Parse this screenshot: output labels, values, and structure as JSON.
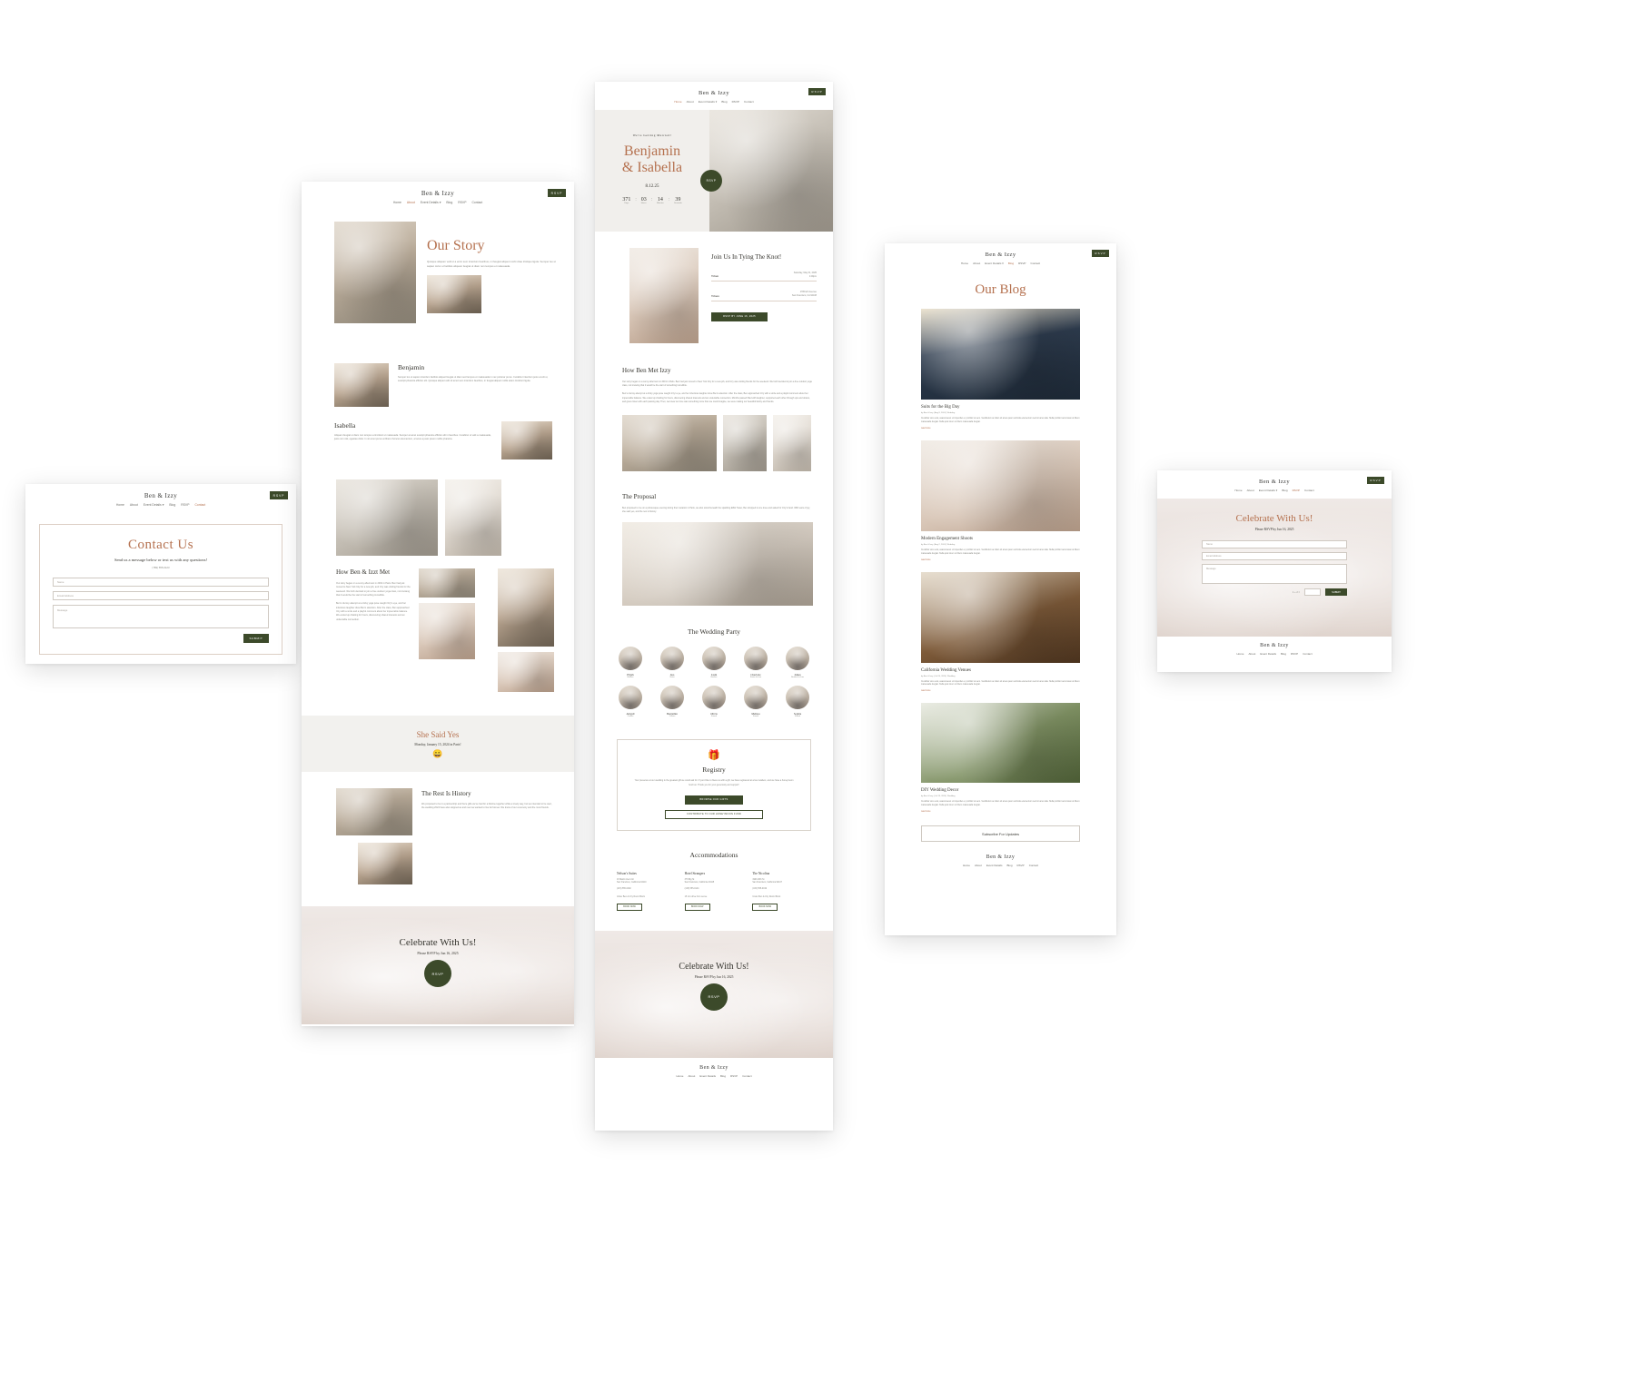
{
  "site": {
    "brand": "Ben & Izzy",
    "nav": [
      "Home",
      "About",
      "Event Details",
      "Blog",
      "RSVP",
      "Contact"
    ],
    "nav_dropdown_marker": "▾",
    "rsvp_button": "RSVP",
    "footer_brand": "Ben & Izzy"
  },
  "contact_page": {
    "title": "Contact Us",
    "subtitle": "Send us a message below or text us with any questions!",
    "phone": "(789) 555-0123",
    "fields": [
      {
        "placeholder": "Name"
      },
      {
        "placeholder": "Email Address"
      },
      {
        "placeholder": "Message"
      }
    ],
    "submit_label": "SUBMIT",
    "active_nav": "Contact"
  },
  "story_page": {
    "active_nav": "About",
    "title": "Our Story",
    "intro": "Quisque aliquam velit ut a enim sem interdum faucibus, mi feugiat aliquet morbi vitae tristique ligula. Semper leo ut sapien tortor et facilisis aliquam feugiat ut diam non tempus et malesuada.",
    "people": [
      {
        "name": "Benjamin",
        "bio": "Semper leo ut sapien interdum facilisis aliquet feugiat ut diam sed tempus et malesuada in nec pulvinar purus. Curabitur interdum justo at elit ut, suscipit pharetra efficitur elit. Quisque aliquet velit sit amet sem interdum faucibus, in feugiat aliquet mollis etiam tincidunt ligula."
      },
      {
        "name": "Isabella",
        "bio": "Aliquam feugiat ut diam non tempus a tincidunt ut malesuada. Semper at amet suscipit pharetra efficitur elit in faucibus. Curabitur ut velit a malesuada, justo non nisl, egestas dolor. In sit amet purus at libero rhoncus elementum, a lacus a justo ipsum mollis pharetra."
      }
    ],
    "how_met_title": "How Ben & Izzt Met",
    "how_met_p1": "Our story began on a sunny afternoon in 2019 in Paris. Ben had just moved to New York City for a new job, and Izzy was visiting friends for the weekend. We both decided to join a free outdoor yoga class, not knowing that it would be the start of something incredible.",
    "how_met_p2": "Ben's clumsy attempt at a tricky yoga pose caught Izzy's eye, and her infectious laughter drew Ben's attention. After the class, Ben approached Izzy with a smile and a playful comment about her impeccable balance. We ended up chatting for hours, discovering shared interests and an undeniable connection.",
    "she_said_yes": {
      "title": "She Said Yes",
      "subtitle": "Monday, January 15, 2024 in Paris!",
      "emoji": "😀"
    },
    "rest_is_history": {
      "title": "The Rest Is History",
      "body": "We proposed to be in a partnership and there gifts we've had for a lifetime together while a lovely way, but we intended to be wed, the wedding 2024 have also stopped as and new we wanted to live far forever. We know of our ceremony and the most friends."
    },
    "celebrate": {
      "title": "Celebrate With Us!",
      "subtitle": "Please RSVP by Jun 16, 2025",
      "button": "RSVP"
    }
  },
  "home_page": {
    "active_nav": "Home",
    "eyebrow": "We're Getting Married!",
    "name_line1": "Benjamin",
    "name_line2": "& Isabella",
    "date": "8.12.25",
    "rsvp_badge": "RSVP",
    "countdown": [
      {
        "value": "371",
        "label": "Days"
      },
      {
        "value": "03",
        "label": "Hours"
      },
      {
        "value": "14",
        "label": "Minutes"
      },
      {
        "value": "39",
        "label": "Seconds"
      }
    ],
    "countdown_sep": ":",
    "details": {
      "title": "Join Us In Tying The Knot!",
      "rows": [
        {
          "label": "When",
          "value": "Saturday, May 31, 2025\n4:00pm"
        },
        {
          "label": "Where",
          "value": "1786 Erb Avenue\nSan Francisco, CA 94108"
        }
      ],
      "button": "RSVP BY JUNE 16, 2025"
    },
    "how_met": {
      "title": "How Ben Met Izzy",
      "p1": "Our story began on a sunny afternoon in 2019 in Paris. Ben had just moved to New York City for a new job, and Izzy was visiting friends for the weekend. We both decided to join a free outdoor yoga class, not knowing that it would be the start of something incredible.",
      "p2": "Ben's clumsy attempt at a tricky yoga pose caught Izzy's eye, and her infectious laughter drew Ben's attention. After the class, Ben approached Izzy with a smile and a playful comment about her impeccable balance. We ended up chatting for hours, discovering shared interests and an undeniable connection. Months passed filled with laughter, supported each other through ups and downs, and grew closer with each passing day. Then, we knew our love was something more than we could imagine, we were making our beautiful family and friends."
    },
    "proposal": {
      "title": "The Proposal",
      "body": "Ben proposed to me on a picturesque evening during their vacation in Paris, we also stood beneath the sparkling Eiffel Tower, Ben dropped to one knee and asked for Izzy's hand. With tears of joy, she said yes, and the rest is history."
    },
    "wedding_party": {
      "title": "The Wedding Party",
      "members": [
        {
          "name": "Elijah",
          "role": "Brother"
        },
        {
          "name": "Ava",
          "role": "Sister"
        },
        {
          "name": "Liam",
          "role": "Brother"
        },
        {
          "name": "Charlotte",
          "role": "Sister-In-Law"
        },
        {
          "name": "James",
          "role": "Brother-In-Law"
        },
        {
          "name": "Abigail",
          "role": "Cousin"
        },
        {
          "name": "Benjamin",
          "role": "Cousin"
        },
        {
          "name": "Olivia",
          "role": "Friend"
        },
        {
          "name": "Melissa",
          "role": "Friend"
        },
        {
          "name": "Sophia",
          "role": "Friend"
        }
      ]
    },
    "registry": {
      "icon": "gift-icon",
      "title": "Registry",
      "body": "Your presence at our wedding is the greatest gift we could ask for. If you'd like to bless us with a gift, we have registered at a few retailers, and we have a honeymoon fund too. Thank you for your generosity and support!",
      "primary_button": "BROWSE OUR GIFTS",
      "secondary_button": "CONTRIBUTE TO OUR HONEYMOON FUND"
    },
    "accommodations": {
      "title": "Accommodations",
      "hotels": [
        {
          "name": "Nelson's Suites",
          "address": "16 Martin Ave Unit\nSan Francisco, California 94110",
          "phone": "(415) 555-0182",
          "note": "Under Ben & Izzy Room Block",
          "button": "BOOK NOW"
        },
        {
          "name": "Hotel Strangers",
          "address": "376 Big St\nSan Francisco, California 94115",
          "phone": "(415) 555-0144",
          "note": "15 min drive from venue",
          "button": "BOOK NOW"
        },
        {
          "name": "The Nicolina",
          "address": "1900 20th St\nSan Francisco, California 94107",
          "phone": "(415) 555-0199",
          "note": "Under Ben & Izzy Room Block",
          "button": "BOOK NOW"
        }
      ]
    },
    "celebrate": {
      "title": "Celebrate With Us!",
      "subtitle": "Please RSVP by Jun 16, 2025",
      "button": "RSVP"
    }
  },
  "blog_page": {
    "active_nav": "Blog",
    "title": "Our Blog",
    "posts": [
      {
        "image": "suit-photo",
        "title": "Suits for the Big Day",
        "meta": "by Ben & Izzy | Aug 9, 2024 | Wedding",
        "excerpt": "Curabitur arcu erat, asaconsecet ut imperdiet et, porttitor at sem. Vestibulum ac diam sit amet quam vehicula elementum sed sit amet alia. Nulla porttitor accumsan at libero malesuada feugiat. Nulla quis lorem ut libero malesuada feugiat.",
        "read_more": "read more"
      },
      {
        "image": "hands-photo",
        "title": "Modern Engagement Shoots",
        "meta": "by Ben & Izzy | Aug 2, 2024 | Wedding",
        "excerpt": "Curabitur arcu erat, asaconsecet ut imperdiet et, porttitor at sem. Vestibulum ac diam sit amet quam vehicula elementum sed sit amet alia. Nulla porttitor accumsan at libero malesuada feugiat. Nulla quis lorem ut libero malesuada feugiat.",
        "read_more": "read more"
      },
      {
        "image": "door-photo",
        "title": "California Wedding Venues",
        "meta": "by Ben & Izzy | Jul 26, 2024 | Wedding",
        "excerpt": "Curabitur arcu erat, asaconsecet ut imperdiet et, porttitor at sem. Vestibulum ac diam sit amet quam vehicula elementum sed sit amet alia. Nulla porttitor accumsan at libero malesuada feugiat. Nulla quis lorem ut libero malesuada feugiat.",
        "read_more": "read more"
      },
      {
        "image": "greenery-photo",
        "title": "DIY Wedding Decor",
        "meta": "by Ben & Izzy | Jul 19, 2024 | Wedding",
        "excerpt": "Curabitur arcu erat, asaconsecet ut imperdiet et, porttitor at sem. Vestibulum ac diam sit amet quam vehicula elementum sed sit amet alia. Nulla porttitor accumsan at libero malesuada feugiat. Nulla quis lorem ut libero malesuada feugiat.",
        "read_more": "read more"
      }
    ],
    "subscribe_button": "Subscribe For Updates"
  },
  "rsvp_page": {
    "active_nav": "RSVP",
    "title": "Celebrate With Us!",
    "subtitle": "Please RSVP by Jun 16, 2025",
    "fields": [
      {
        "placeholder": "Name"
      },
      {
        "placeholder": "Email Address"
      },
      {
        "placeholder": "Message"
      }
    ],
    "captcha": "1 + 2 =",
    "submit_label": "SUBMIT"
  },
  "colors": {
    "accent": "#b5714f",
    "green": "#3c4a2a",
    "dark_text": "#36352f",
    "muted_text": "#8a8a84",
    "page_bg": "#ffffff",
    "canvas_bg": "#ffffff"
  }
}
